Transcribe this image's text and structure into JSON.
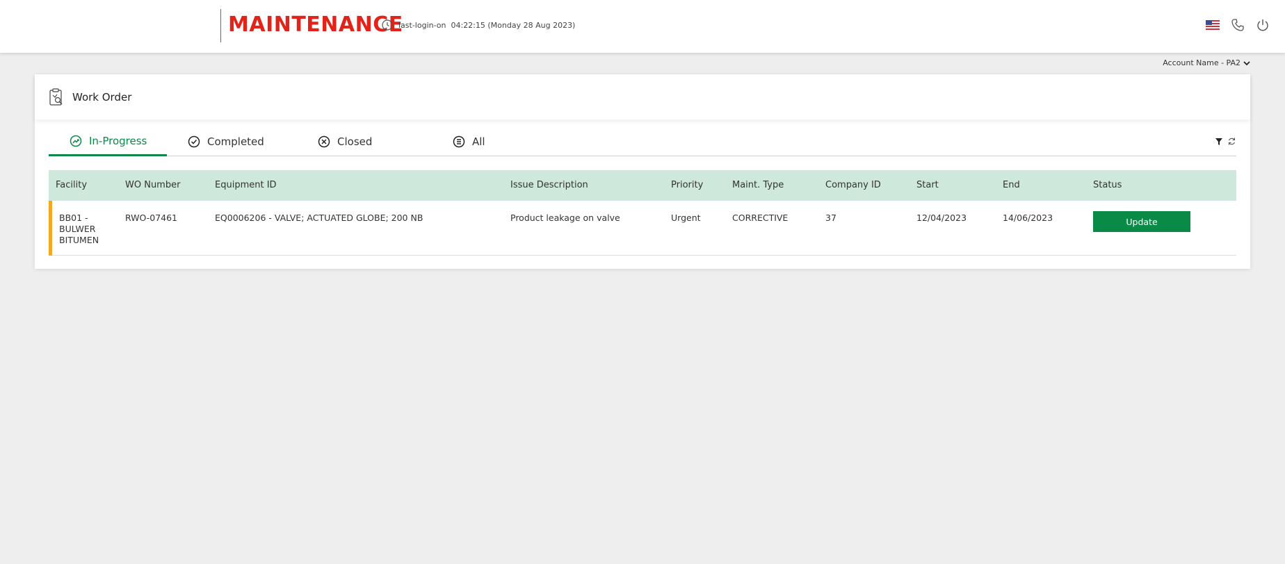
{
  "header": {
    "brand": "MAINTENANCE",
    "login_label": "last-login-on",
    "login_time": "04:22:15 (Monday 28 Aug 2023)",
    "icons": [
      "us-flag-icon",
      "phone-icon",
      "power-icon"
    ]
  },
  "account": {
    "label": "Account Name - PA2"
  },
  "card": {
    "title": "Work Order"
  },
  "tabs": [
    {
      "label": "In-Progress",
      "icon": "trend-up-circle-icon",
      "active": true
    },
    {
      "label": "Completed",
      "icon": "check-circle-icon",
      "active": false
    },
    {
      "label": "Closed",
      "icon": "x-circle-icon",
      "active": false
    },
    {
      "label": "All",
      "icon": "list-circle-icon",
      "active": false
    }
  ],
  "toolbar": {
    "icons": [
      "filter-icon",
      "refresh-icon"
    ]
  },
  "table": {
    "columns": [
      "Facility",
      "WO Number",
      "Equipment ID",
      "Issue Description",
      "Priority",
      "Maint. Type",
      "Company ID",
      "Start",
      "End",
      "Status"
    ],
    "rows": [
      {
        "facility": "BB01 - BULWER BITUMEN",
        "wo_number": "RWO-07461",
        "equipment_id": "EQ0006206 - VALVE; ACTUATED GLOBE; 200 NB",
        "issue": "Product leakage on valve",
        "priority": "Urgent",
        "maint_type": "CORRECTIVE",
        "company_id": "37",
        "start": "12/04/2023",
        "end": "14/06/2023",
        "status_button": "Update"
      }
    ]
  },
  "colors": {
    "brand": "#e2231a",
    "accent": "#0a8a47",
    "header_row": "#cfe8dc",
    "row_flag": "#f5a623"
  }
}
